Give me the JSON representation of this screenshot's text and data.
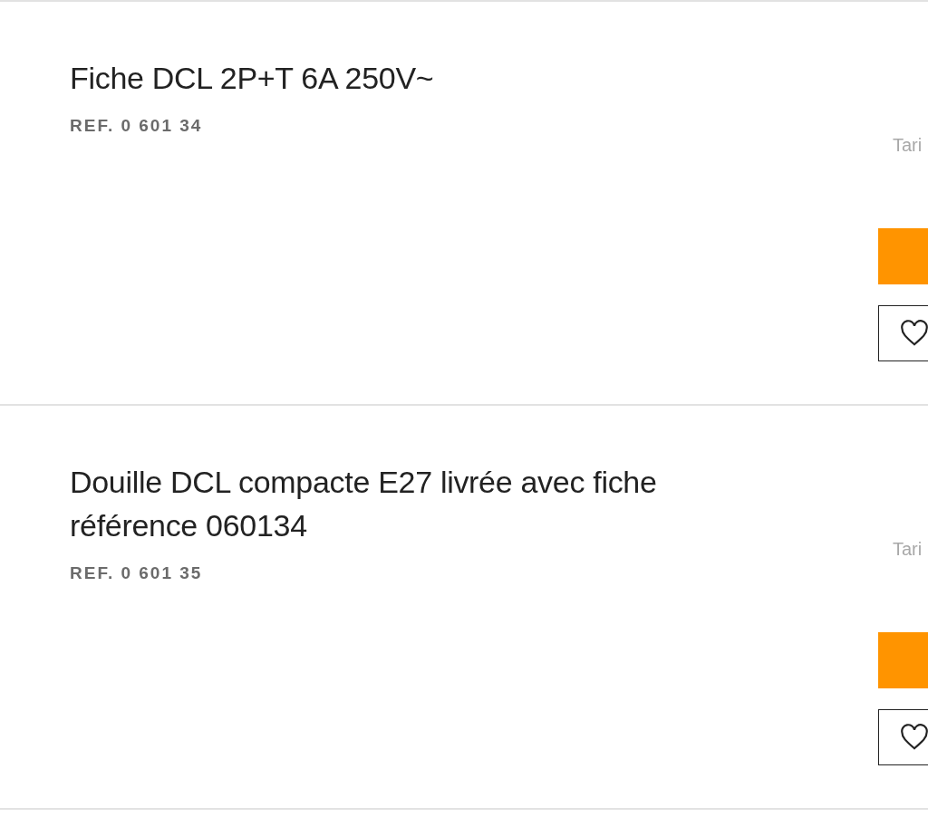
{
  "products": [
    {
      "title": "Fiche DCL 2P+T 6A 250V~",
      "ref": "REF. 0 601 34",
      "price_label": "Tari"
    },
    {
      "title": "Douille DCL compacte E27 livrée avec fiche référence 060134",
      "ref": "REF. 0 601 35",
      "price_label": "Tari"
    }
  ]
}
